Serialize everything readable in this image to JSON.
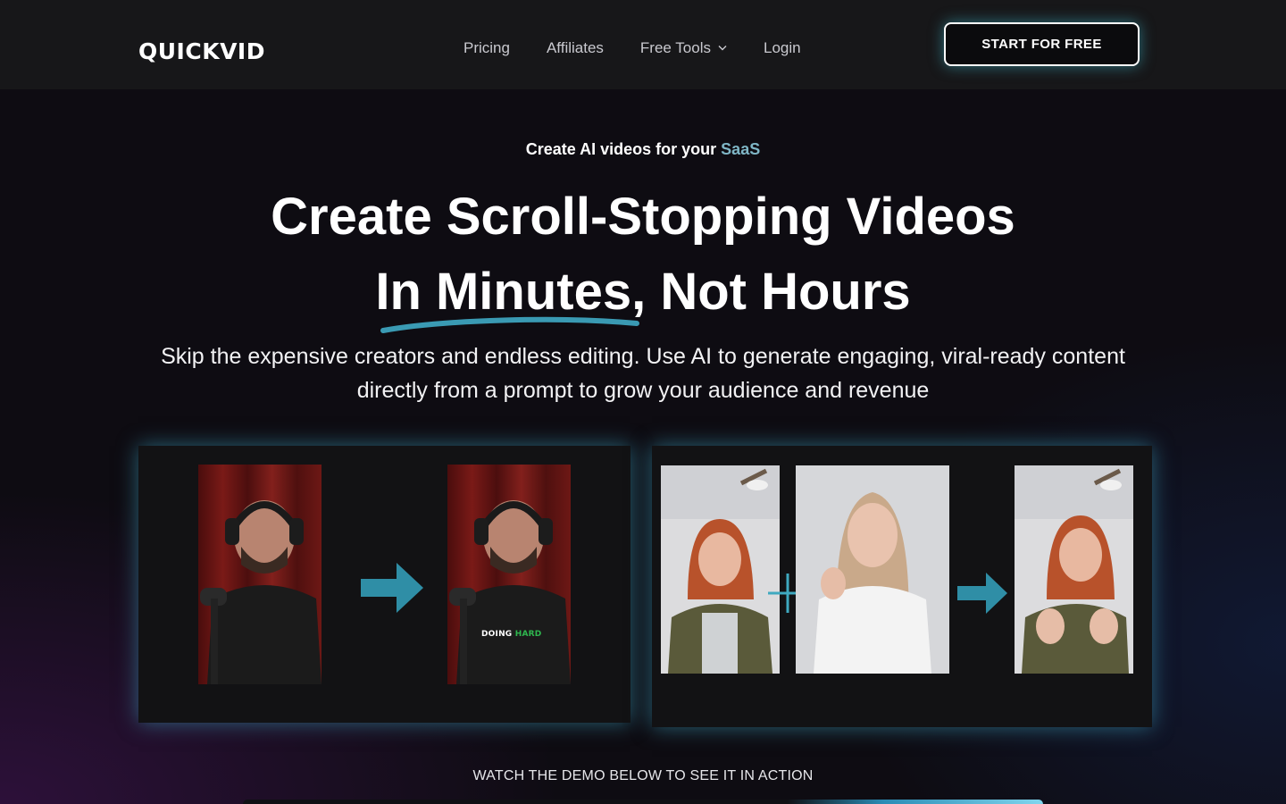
{
  "brand": {
    "logo_text": "QUICKVID"
  },
  "nav": {
    "links": [
      {
        "label": "Pricing"
      },
      {
        "label": "Affiliates"
      },
      {
        "label": "Free Tools"
      },
      {
        "label": "Login"
      }
    ],
    "cta_label": "START FOR FREE"
  },
  "hero": {
    "eyebrow_prefix": "Create AI videos for your ",
    "eyebrow_highlight": "SaaS",
    "headline_line1": "Create Scroll-Stopping Videos",
    "headline_line2_highlight": "In Minutes",
    "headline_line2_rest": ", Not Hours",
    "subtext": "Skip the expensive creators and endless editing. Use AI to generate engaging, viral-ready content directly from a prompt to grow your audience and revenue"
  },
  "demos": {
    "left_caption_prefix": "DOING ",
    "left_caption_highlight": "HARD"
  },
  "watch_demo_label": "WATCH THE DEMO BELOW TO SEE IT IN ACTION",
  "colors": {
    "accent_teal": "#2f8ea6",
    "underline": "#3a9ab3",
    "nav_bg": "#171719",
    "page_bg": "#0e0c12"
  },
  "icons": [
    "chevron-down-icon",
    "arrow-right-icon",
    "plus-icon"
  ]
}
